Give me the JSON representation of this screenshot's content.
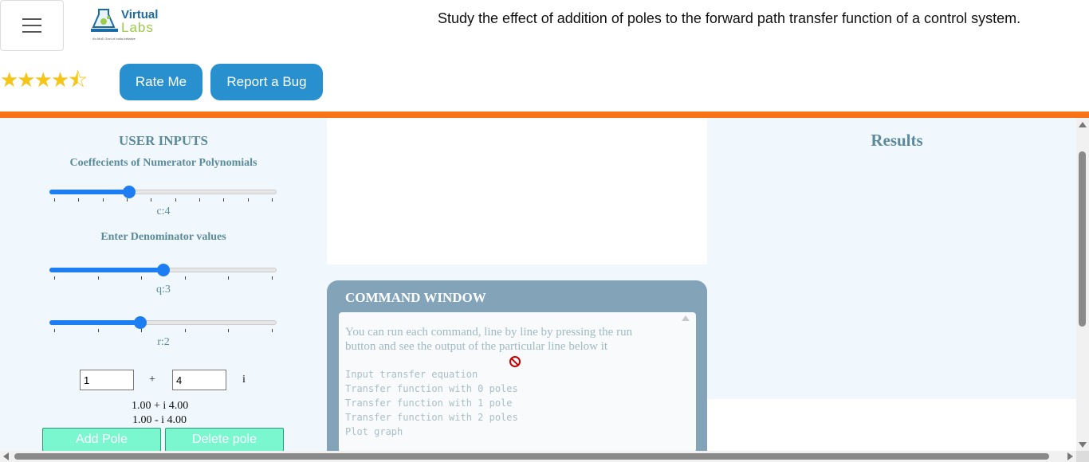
{
  "header": {
    "logo": {
      "line1": "Virtual",
      "line2": "Labs",
      "tagline": "An MoE Govt of India Initiative"
    },
    "title": "Study the effect of addition of poles to the forward path transfer function of a control system.",
    "rating": {
      "stars_filled": 4.5,
      "stars_total": 5,
      "glyphs": "★★★★⯪"
    },
    "rate_button": "Rate Me",
    "bug_button": "Report a Bug",
    "accent_color": "#f97316"
  },
  "inputs": {
    "heading": "USER INPUTS",
    "numerator_heading": "Coeffecients of Numerator Polynomials",
    "denominator_heading": "Enter Denominator values",
    "slider_c": {
      "label": "c:4",
      "fraction": 0.35
    },
    "slider_q": {
      "label": "q:3",
      "fraction": 0.5
    },
    "slider_r": {
      "label": "r:2",
      "fraction": 0.4
    },
    "real_value": "1",
    "plus": "+",
    "imag_value": "4",
    "i_symbol": "i",
    "pole_pos": "1.00 + i 4.00",
    "pole_neg": "1.00 - i 4.00",
    "add_pole": "Add Pole",
    "delete_pole": "Delete pole"
  },
  "command_window": {
    "title": "COMMAND WINDOW",
    "description": "You can run each command, line by line by pressing the run button and see the output of the particular line below it",
    "lines": [
      "Input transfer equation",
      "Transfer function with 0 poles",
      "Transfer function with 1 pole",
      "Transfer function with 2 poles",
      "Plot graph"
    ]
  },
  "results": {
    "title": "Results"
  }
}
